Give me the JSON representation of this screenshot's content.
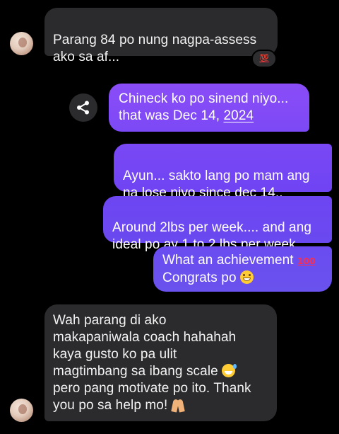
{
  "messages": [
    {
      "from": "other",
      "text": "Parang 84 po nung nagpa-assess\nako sa af...",
      "reaction": "💯"
    },
    {
      "from": "me",
      "text_main": "Chineck ko po sinend niyo...\nthat was Dec 14, ",
      "text_link": "2024"
    },
    {
      "from": "me",
      "text": "Ayun... sakto lang po mam ang\nna lose niyo since dec 14.."
    },
    {
      "from": "me",
      "text": "Around 2lbs per week.... and ang\nideal po ay 1 to 2 lbs per week"
    },
    {
      "from": "me",
      "text_line1": "What an achievement ",
      "emoji1": "💯",
      "text_line2": "Congrats po ",
      "emoji2": "😁"
    },
    {
      "from": "other",
      "text_main": "Wah parang di ako\nmakapaniwala coach hahahah\nkaya gusto ko pa ulit\nmagtimbang sa ibang scale ",
      "emoji_a": "😅",
      "text_rest": "\npero pang motivate po ito. Thank\nyou po sa help mo! ",
      "emoji_b": "🙏"
    }
  ],
  "icons": {
    "share": "share-icon",
    "avatar": "contact-avatar"
  },
  "colors": {
    "background": "#000000",
    "incoming_bubble": "#2b2b2d",
    "outgoing_bubble_top": "#8a4df7",
    "outgoing_bubble_bottom": "#6a52ee",
    "reaction_red": "#ff2d4a"
  }
}
